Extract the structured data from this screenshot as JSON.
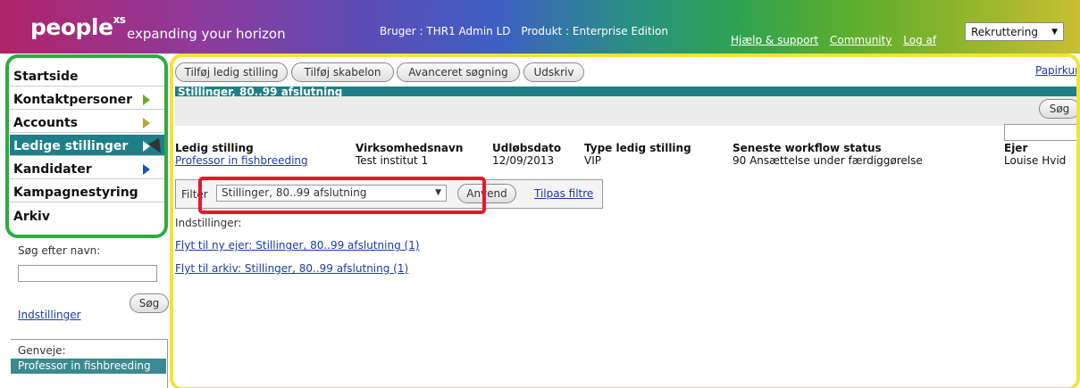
{
  "header": {
    "logo": "people",
    "logo_sup": "xs",
    "tagline": "expanding your horizon",
    "user": "Bruger : THR1 Admin LD",
    "product": "Produkt : Enterprise Edition",
    "links": [
      "Hjælp & support",
      "Community",
      "Log af"
    ],
    "module": "Rekruttering"
  },
  "nav": {
    "items": [
      {
        "label": "Startside"
      },
      {
        "label": "Kontaktpersoner"
      },
      {
        "label": "Accounts"
      },
      {
        "label": "Ledige stillinger"
      },
      {
        "label": "Kandidater"
      },
      {
        "label": "Kampagnestyring"
      },
      {
        "label": "Arkiv"
      }
    ]
  },
  "sidebar": {
    "search_label": "Søg efter navn:",
    "search_button": "Søg",
    "settings_link": "Indstillinger",
    "shortcuts_label": "Genveje:",
    "shortcut_item": "Professor in fishbreeding"
  },
  "toolbar": {
    "buttons": [
      "Tilføj ledig stilling",
      "Tilføj skabelon",
      "Avanceret søgning",
      "Udskriv"
    ],
    "trash_link": "Papirkur"
  },
  "list": {
    "title": "Stillinger, 80..99 afslutning",
    "search_button": "Søg",
    "columns": [
      "Ledig stilling",
      "Virksomhedsnavn",
      "Udløbsdato",
      "Type ledig stilling",
      "Seneste workflow status",
      "Ejer"
    ],
    "rows": [
      [
        "Professor in fishbreeding",
        "Test institut 1",
        "12/09/2013",
        "VIP",
        "90 Ansættelse under færdiggørelse",
        "Louise Hvid"
      ]
    ]
  },
  "filter": {
    "label": "Filter",
    "selected": "Stillinger, 80..99 afslutning",
    "apply_button": "Anvend",
    "customize_link": "Tilpas filtre"
  },
  "settings_section": {
    "label": "Indstillinger:",
    "links": [
      "Flyt til ny ejer: Stillinger, 80..99 afslutning (1)",
      "Flyt til arkiv: Stillinger, 80..99 afslutning (1)"
    ]
  },
  "colors": {
    "teal": "#1e7f88",
    "nav_outline": "#2eab3f",
    "main_outline": "#f2e33a",
    "highlight": "#e8172a",
    "link": "#1a3ca8"
  }
}
